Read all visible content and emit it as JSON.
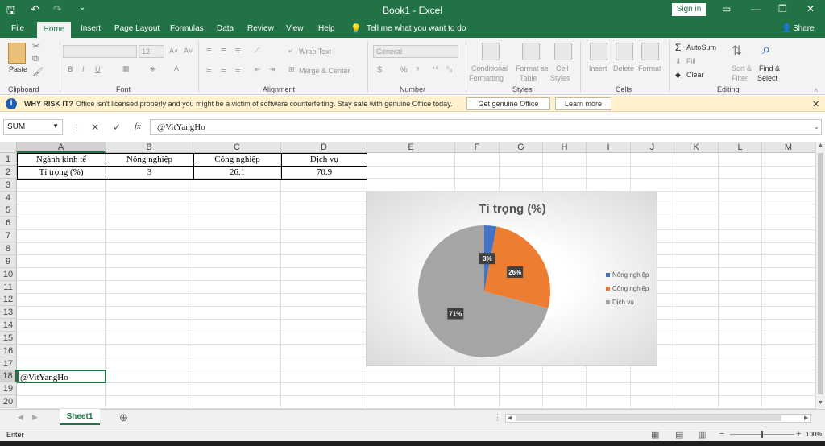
{
  "window": {
    "title": "Book1 - Excel",
    "sign_in": "Sign in",
    "ribbon_display_icon": "ribbon-display-icon",
    "minimize": "—",
    "restore": "❐",
    "close": "✕"
  },
  "ribbon_tabs": [
    "File",
    "Home",
    "Insert",
    "Page Layout",
    "Formulas",
    "Data",
    "Review",
    "View",
    "Help"
  ],
  "tell_me": "Tell me what you want to do",
  "share": "Share",
  "ribbon": {
    "clipboard": {
      "paste": "Paste",
      "label": "Clipboard"
    },
    "font": {
      "font_size": "12",
      "label": "Font"
    },
    "alignment": {
      "wrap_text": "Wrap Text",
      "merge_center": "Merge & Center",
      "label": "Alignment"
    },
    "number": {
      "format": "General",
      "label": "Number"
    },
    "styles": {
      "conditional": "Conditional",
      "formatting": "Formatting",
      "format_as": "Format as",
      "table": "Table",
      "cell": "Cell",
      "styles": "Styles",
      "label": "Styles"
    },
    "cells": {
      "insert": "Insert",
      "delete": "Delete",
      "format": "Format",
      "label": "Cells"
    },
    "editing": {
      "autosum": "AutoSum",
      "fill": "Fill",
      "clear": "Clear",
      "sort": "Sort &",
      "filter": "Filter",
      "find": "Find &",
      "select": "Select",
      "label": "Editing"
    }
  },
  "warning": {
    "bold": "WHY RISK IT?",
    "text": "Office isn't licensed properly and you might be a victim of software counterfeiting. Stay safe with genuine Office today.",
    "button1": "Get genuine Office",
    "button2": "Learn more"
  },
  "formula_bar": {
    "name_box": "SUM",
    "fx": "fx",
    "content": "@VitYangHo"
  },
  "columns": [
    "A",
    "B",
    "C",
    "D",
    "E",
    "F",
    "G",
    "H",
    "I",
    "J",
    "K",
    "L",
    "M"
  ],
  "rows": [
    "1",
    "2",
    "3",
    "4",
    "5",
    "6",
    "7",
    "8",
    "9",
    "10",
    "11",
    "12",
    "13",
    "14",
    "15",
    "16",
    "17",
    "18",
    "19",
    "20"
  ],
  "table": {
    "headers": [
      "Ngành kinh tế",
      "Nông nghiệp",
      "Công nghiệp",
      "Dịch vụ"
    ],
    "row": [
      "Tỉ trọng (%)",
      "3",
      "26.1",
      "70.9"
    ]
  },
  "active_cell_text": "@VitYangHo",
  "chart_data": {
    "type": "pie",
    "title": "Tỉ trọng (%)",
    "categories": [
      "Nông nghiệp",
      "Công nghiệp",
      "Dịch vụ"
    ],
    "values": [
      3,
      26.1,
      70.9
    ],
    "data_labels": [
      "3%",
      "26%",
      "71%"
    ],
    "colors": [
      "#4472c4",
      "#ed7d31",
      "#a5a5a5"
    ],
    "legend_position": "right"
  },
  "sheet_tab": "Sheet1",
  "status": {
    "mode": "Enter",
    "zoom": "100%"
  }
}
